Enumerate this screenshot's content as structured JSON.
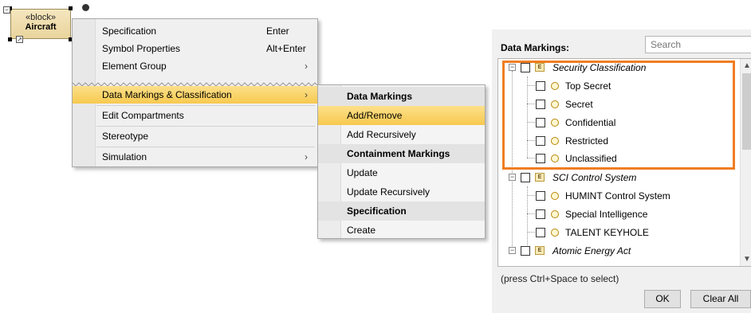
{
  "block": {
    "stereotype": "«block»",
    "name": "Aircraft"
  },
  "context_menu": {
    "items": [
      {
        "label": "Specification",
        "shortcut": "Enter"
      },
      {
        "label": "Symbol Properties",
        "shortcut": "Alt+Enter"
      },
      {
        "label": "Element Group",
        "arrow": "›"
      },
      {
        "label": "Data Markings & Classification",
        "arrow": "›"
      },
      {
        "label": "Edit Compartments"
      },
      {
        "label": "Stereotype"
      },
      {
        "label": "Simulation",
        "arrow": "›"
      }
    ]
  },
  "submenu": {
    "items": [
      {
        "label": "Data Markings",
        "type": "header"
      },
      {
        "label": "Add/Remove",
        "type": "item"
      },
      {
        "label": "Add Recursively",
        "type": "item"
      },
      {
        "label": "Containment Markings",
        "type": "header"
      },
      {
        "label": "Update",
        "type": "item"
      },
      {
        "label": "Update Recursively",
        "type": "item"
      },
      {
        "label": "Specification",
        "type": "header"
      },
      {
        "label": "Create",
        "type": "item"
      }
    ]
  },
  "panel": {
    "label": "Data Markings:",
    "search_placeholder": "Search",
    "tree": [
      {
        "label": "Security Classification",
        "level": 0
      },
      {
        "label": "Top Secret",
        "level": 1
      },
      {
        "label": "Secret",
        "level": 1
      },
      {
        "label": "Confidential",
        "level": 1
      },
      {
        "label": "Restricted",
        "level": 1
      },
      {
        "label": "Unclassified",
        "level": 1
      },
      {
        "label": "SCI Control System",
        "level": 0
      },
      {
        "label": "HUMINT Control System",
        "level": 1
      },
      {
        "label": "Special Intelligence",
        "level": 1
      },
      {
        "label": "TALENT KEYHOLE",
        "level": 1
      },
      {
        "label": "Atomic Energy Act",
        "level": 0
      }
    ],
    "hint": "(press Ctrl+Space to select)",
    "ok_label": "OK",
    "clear_label": "Clear All"
  },
  "colors": {
    "highlight": "#f07d22",
    "selection": "#f7c94f",
    "block_fill": "#f0deb0"
  }
}
